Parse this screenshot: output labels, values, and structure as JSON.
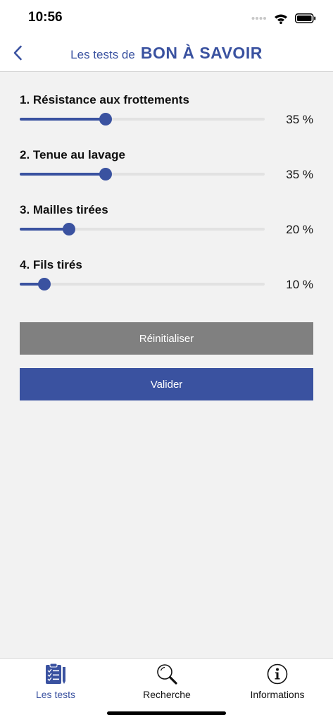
{
  "status_bar": {
    "time": "10:56"
  },
  "nav": {
    "title_prefix": "Les tests de",
    "title_brand": "BON À SAVOIR"
  },
  "tests": [
    {
      "label": "1. Résistance aux frottements",
      "value": 35,
      "value_text": "35 %"
    },
    {
      "label": "2. Tenue au lavage",
      "value": 35,
      "value_text": "35 %"
    },
    {
      "label": "3. Mailles tirées",
      "value": 20,
      "value_text": "20 %"
    },
    {
      "label": "4. Fils tirés",
      "value": 10,
      "value_text": "10 %"
    }
  ],
  "buttons": {
    "reset_label": "Réinitialiser",
    "validate_label": "Valider"
  },
  "tab_bar": {
    "items": [
      {
        "label": "Les tests",
        "icon": "clipboard-checklist-icon",
        "active": true
      },
      {
        "label": "Recherche",
        "icon": "magnifier-icon",
        "active": false
      },
      {
        "label": "Informations",
        "icon": "info-circle-icon",
        "active": false
      }
    ]
  },
  "colors": {
    "accent": "#3a52a0",
    "reset_button": "#808080",
    "background": "#f2f2f2"
  }
}
